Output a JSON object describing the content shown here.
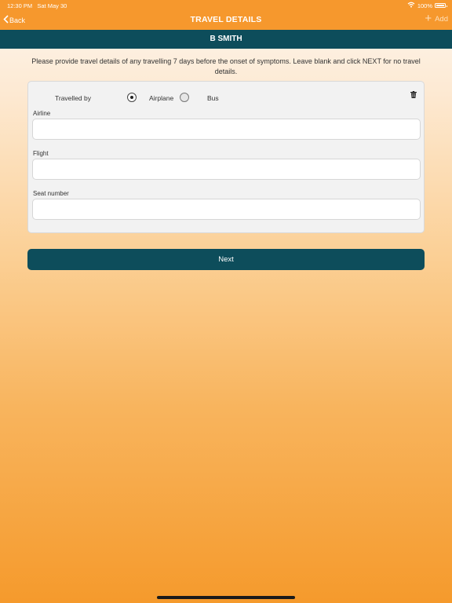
{
  "status": {
    "time": "12:30 PM",
    "date": "Sat May 30",
    "battery": "100%"
  },
  "nav": {
    "back_label": "Back",
    "title": "TRAVEL DETAILS",
    "add_label": "Add"
  },
  "patient": {
    "name": "B SMITH"
  },
  "instructions": "Please provide travel details of any travelling 7 days before the onset of symptoms. Leave blank and click NEXT for no travel details.",
  "travel": {
    "travelled_by_label": "Travelled by",
    "options": [
      {
        "label": "Airplane",
        "selected": true
      },
      {
        "label": "Bus",
        "selected": false
      }
    ],
    "fields": [
      {
        "label": "Airline",
        "value": ""
      },
      {
        "label": "Flight",
        "value": ""
      },
      {
        "label": "Seat number",
        "value": ""
      }
    ]
  },
  "actions": {
    "next_label": "Next"
  },
  "colors": {
    "header": "#f6982d",
    "accent": "#0d4d5b"
  }
}
